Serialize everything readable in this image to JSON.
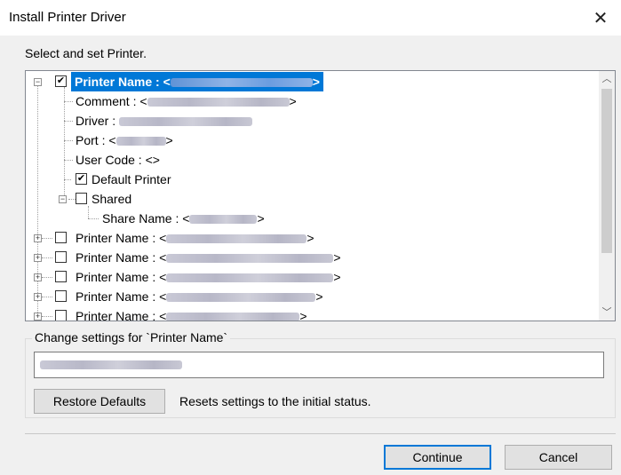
{
  "window": {
    "title": "Install Printer Driver",
    "close_glyph": "✕"
  },
  "instruction": "Select and set Printer.",
  "tree": {
    "selected_prefix": "Printer Name : <",
    "comment_prefix": "Comment : <",
    "driver_prefix": "Driver : ",
    "port_prefix": "Port : <",
    "user_code": "User Code : <>",
    "default_printer": "Default Printer",
    "shared": "Shared",
    "share_name_prefix": "Share Name : <",
    "printer_prefix": "Printer Name : <",
    "close_bracket": ">"
  },
  "settings": {
    "group_label": "Change settings for `Printer Name`",
    "restore_button": "Restore Defaults",
    "restore_description": "Resets settings to the initial status."
  },
  "footer": {
    "continue_button": "Continue",
    "cancel_button": "Cancel"
  },
  "icons": {
    "scroll_up": "scroll-up-icon",
    "scroll_down": "scroll-down-icon"
  },
  "colors": {
    "selection": "#0078d7",
    "default_button_border": "#0078d7"
  }
}
